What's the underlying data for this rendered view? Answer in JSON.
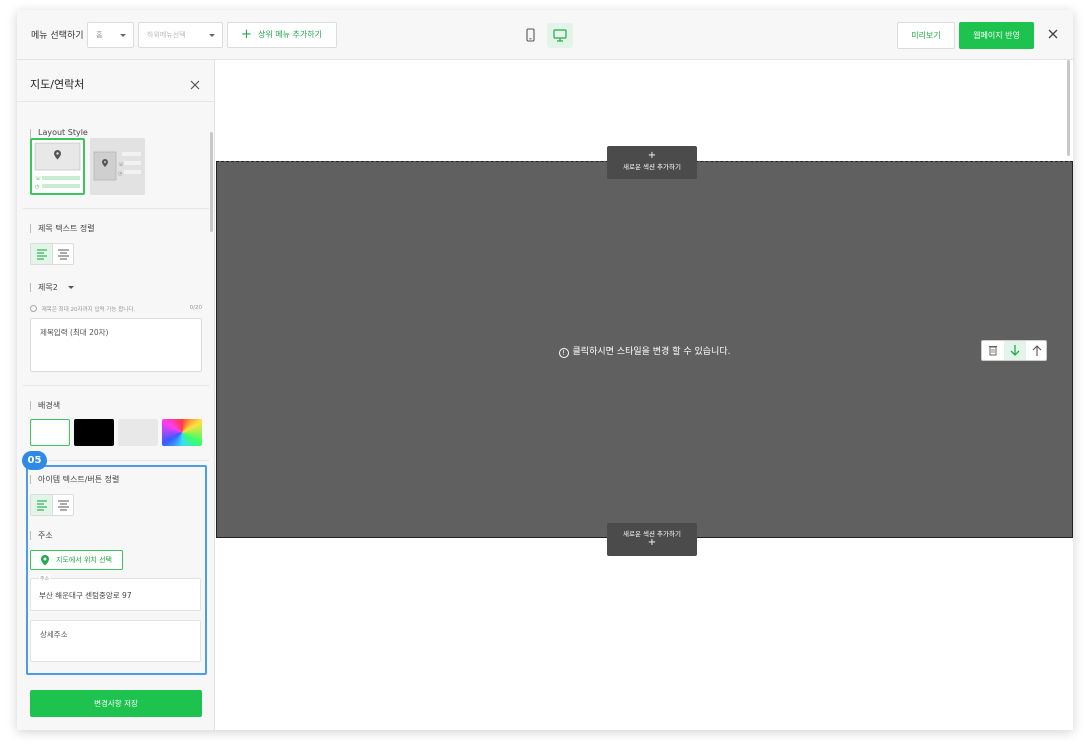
{
  "topbar": {
    "menu_select_label": "메뉴 선택하기",
    "menu_select_value": "홈",
    "submenu_placeholder": "하위메뉴선택",
    "add_top_menu": "상위 메뉴 추가하기",
    "preview": "미리보기",
    "publish": "웹페이지 반영"
  },
  "sidebar": {
    "title": "지도/연락처",
    "layout_style_label": "Layout Style",
    "title_align_label": "제목 텍스트 정렬",
    "heading_select": "제목2",
    "title_hint": "제목은 최대 20자까지 입력 가능 합니다.",
    "title_count": "0/20",
    "title_placeholder": "제목입력 (최대 20자)",
    "bg_color_label": "배경색",
    "highlight_badge": "05",
    "item_align_label": "아이템 텍스트/버튼 정렬",
    "address_label": "주소",
    "map_pick_button": "지도에서 위치 선택",
    "address_floating_label": "주소",
    "address_value": "부산 해운대구 센텀중앙로 97",
    "detail_address_placeholder": "상세주소",
    "save_button": "변경사항 저장"
  },
  "canvas": {
    "add_section": "새로운 섹션 추가하기",
    "section_message": "클릭하시면 스타일을 변경 할 수 있습니다."
  },
  "colors": {
    "accent": "#1ec24f",
    "highlight": "#2f8ae5",
    "section_bg": "#5f605f"
  }
}
